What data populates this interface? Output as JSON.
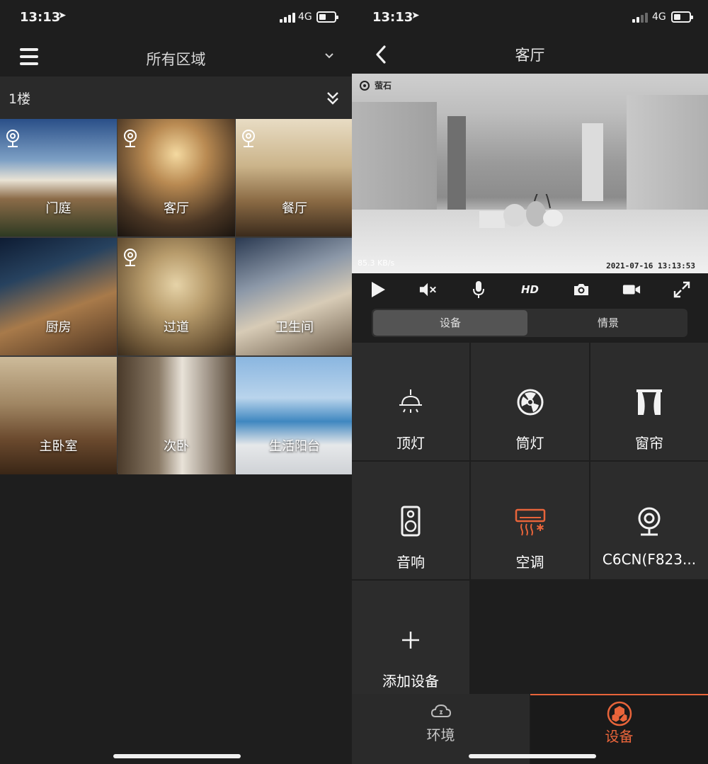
{
  "left": {
    "status": {
      "time": "13:13",
      "network": "4G"
    },
    "header": {
      "title": "所有区域"
    },
    "floor": {
      "label": "1楼"
    },
    "rooms": [
      {
        "name": "门庭",
        "has_camera": true
      },
      {
        "name": "客厅",
        "has_camera": true
      },
      {
        "name": "餐厅",
        "has_camera": true
      },
      {
        "name": "厨房",
        "has_camera": false
      },
      {
        "name": "过道",
        "has_camera": true
      },
      {
        "name": "卫生间",
        "has_camera": false
      },
      {
        "name": "主卧室",
        "has_camera": false
      },
      {
        "name": "次卧",
        "has_camera": false
      },
      {
        "name": "生活阳台",
        "has_camera": false
      }
    ]
  },
  "right": {
    "status": {
      "time": "13:13",
      "network": "4G"
    },
    "header": {
      "title": "客厅"
    },
    "video": {
      "brand": "萤石",
      "bitrate": "85.3 KB/s",
      "timestamp": "2021-07-16  13:13:53"
    },
    "controls": {
      "hd_label": "HD"
    },
    "segment": {
      "devices": "设备",
      "scenes": "情景"
    },
    "devices": [
      {
        "label": "顶灯",
        "icon": "ceiling-light-icon"
      },
      {
        "label": "筒灯",
        "icon": "downlight-icon"
      },
      {
        "label": "窗帘",
        "icon": "curtain-icon"
      },
      {
        "label": "音响",
        "icon": "speaker-icon"
      },
      {
        "label": "空调",
        "icon": "air-conditioner-icon"
      },
      {
        "label": "C6CN(F823...",
        "icon": "camera-icon"
      },
      {
        "label": "添加设备",
        "icon": "plus-icon"
      }
    ],
    "tabs": {
      "environment": "环境",
      "devices": "设备"
    },
    "colors": {
      "accent": "#e8643a"
    }
  }
}
